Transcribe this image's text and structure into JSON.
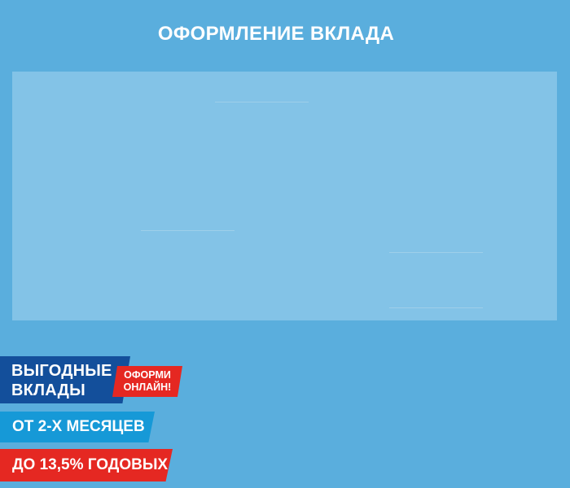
{
  "header": {
    "title": "ОФОРМЛЕНИЕ ВКЛАДА"
  },
  "promo": {
    "title_line1": "ВЫГОДНЫЕ",
    "title_line2": "ВКЛАДЫ",
    "cta_line1": "ОФОРМИ",
    "cta_line2": "ОНЛАЙН!",
    "period": "ОТ 2-Х МЕСЯЦЕВ",
    "rate": "ДО 13,5% ГОДОВЫХ"
  },
  "colors": {
    "background": "#5aaedd",
    "panel": "#83c3e7",
    "brand_blue": "#134f9b",
    "accent_blue": "#1699d7",
    "accent_red": "#e52822"
  }
}
